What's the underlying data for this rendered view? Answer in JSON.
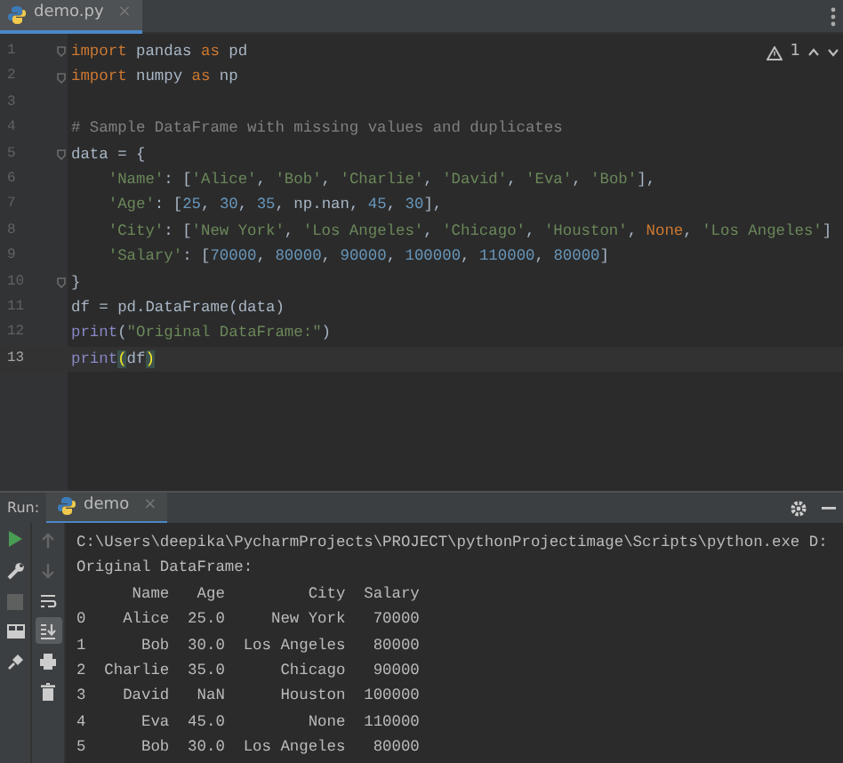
{
  "editor_tab": {
    "label": "demo.py",
    "close": "×",
    "selected": true
  },
  "inspection": {
    "count": "1"
  },
  "code_lines": [
    {
      "number": "1",
      "fold": true,
      "tokens": [
        {
          "kind": "kw",
          "text": "import"
        },
        {
          "kind": "p",
          "text": " pandas "
        },
        {
          "kind": "kw",
          "text": "as"
        },
        {
          "kind": "p",
          "text": " pd"
        }
      ]
    },
    {
      "number": "2",
      "fold": true,
      "tokens": [
        {
          "kind": "kw",
          "text": "import"
        },
        {
          "kind": "p",
          "text": " numpy "
        },
        {
          "kind": "kw",
          "text": "as"
        },
        {
          "kind": "p",
          "text": " np"
        }
      ]
    },
    {
      "number": "3",
      "fold": false
    },
    {
      "number": "4",
      "fold": false,
      "tokens": [
        {
          "kind": "cm",
          "text": "# Sample DataFrame with missing values and duplicates"
        }
      ]
    },
    {
      "number": "5",
      "fold": true,
      "tokens": [
        {
          "kind": "p",
          "text": "data = {"
        }
      ]
    },
    {
      "number": "6",
      "fold": false,
      "tokens": [
        {
          "kind": "s",
          "text": "    'Name'"
        },
        {
          "kind": "p",
          "text": ": ["
        },
        {
          "kind": "s",
          "text": "'Alice'"
        },
        {
          "kind": "p",
          "text": ", "
        },
        {
          "kind": "s",
          "text": "'Bob'"
        },
        {
          "kind": "p",
          "text": ", "
        },
        {
          "kind": "s",
          "text": "'Charlie'"
        },
        {
          "kind": "p",
          "text": ", "
        },
        {
          "kind": "s",
          "text": "'David'"
        },
        {
          "kind": "p",
          "text": ", "
        },
        {
          "kind": "s",
          "text": "'Eva'"
        },
        {
          "kind": "p",
          "text": ", "
        },
        {
          "kind": "s",
          "text": "'Bob'"
        },
        {
          "kind": "p",
          "text": "],"
        }
      ]
    },
    {
      "number": "7",
      "fold": false,
      "tokens": [
        {
          "kind": "s",
          "text": "    'Age'"
        },
        {
          "kind": "p",
          "text": ": ["
        },
        {
          "kind": "n",
          "text": "25"
        },
        {
          "kind": "p",
          "text": ", "
        },
        {
          "kind": "n",
          "text": "30"
        },
        {
          "kind": "p",
          "text": ", "
        },
        {
          "kind": "n",
          "text": "35"
        },
        {
          "kind": "p",
          "text": ", np.nan, "
        },
        {
          "kind": "n",
          "text": "45"
        },
        {
          "kind": "p",
          "text": ", "
        },
        {
          "kind": "n",
          "text": "30"
        },
        {
          "kind": "p",
          "text": "],"
        }
      ]
    },
    {
      "number": "8",
      "fold": false,
      "tokens": [
        {
          "kind": "s",
          "text": "    'City'"
        },
        {
          "kind": "p",
          "text": ": ["
        },
        {
          "kind": "s",
          "text": "'New York'"
        },
        {
          "kind": "p",
          "text": ", "
        },
        {
          "kind": "s",
          "text": "'Los Angeles'"
        },
        {
          "kind": "p",
          "text": ", "
        },
        {
          "kind": "s",
          "text": "'Chicago'"
        },
        {
          "kind": "p",
          "text": ", "
        },
        {
          "kind": "s",
          "text": "'Houston'"
        },
        {
          "kind": "p",
          "text": ", "
        },
        {
          "kind": "kw",
          "text": "None"
        },
        {
          "kind": "p",
          "text": ", "
        },
        {
          "kind": "s",
          "text": "'Los Angeles'"
        },
        {
          "kind": "p",
          "text": "]"
        }
      ]
    },
    {
      "number": "9",
      "fold": false,
      "tokens": [
        {
          "kind": "s",
          "text": "    'Salary'"
        },
        {
          "kind": "p",
          "text": ": ["
        },
        {
          "kind": "n",
          "text": "70000"
        },
        {
          "kind": "p",
          "text": ", "
        },
        {
          "kind": "n",
          "text": "80000"
        },
        {
          "kind": "p",
          "text": ", "
        },
        {
          "kind": "n",
          "text": "90000"
        },
        {
          "kind": "p",
          "text": ", "
        },
        {
          "kind": "n",
          "text": "100000"
        },
        {
          "kind": "p",
          "text": ", "
        },
        {
          "kind": "n",
          "text": "110000"
        },
        {
          "kind": "p",
          "text": ", "
        },
        {
          "kind": "n",
          "text": "80000"
        },
        {
          "kind": "p",
          "text": "]"
        }
      ]
    },
    {
      "number": "10",
      "fold": true,
      "tokens": [
        {
          "kind": "p",
          "text": "}"
        }
      ]
    },
    {
      "number": "11",
      "fold": false,
      "tokens": [
        {
          "kind": "p",
          "text": "df = pd.DataFrame(data)"
        }
      ]
    },
    {
      "number": "12",
      "fold": false,
      "tokens": [
        {
          "kind": "fn",
          "text": "print"
        },
        {
          "kind": "p",
          "text": "("
        },
        {
          "kind": "s",
          "text": "\"Original DataFrame:\""
        },
        {
          "kind": "p",
          "text": ")"
        }
      ]
    },
    {
      "number": "13",
      "fold": false,
      "current": true,
      "tokens": [
        {
          "kind": "fn",
          "text": "print"
        },
        {
          "kind": "br",
          "text": "("
        },
        {
          "kind": "p",
          "text": "df"
        },
        {
          "kind": "br",
          "text": ")"
        }
      ]
    }
  ],
  "run_panel": {
    "label": "Run:",
    "tab": {
      "label": "demo",
      "close": "×",
      "selected": true
    }
  },
  "console_lines": [
    "C:\\Users\\deepika\\PycharmProjects\\PROJECT\\pythonProjectimage\\Scripts\\python.exe D:",
    "Original DataFrame:",
    "      Name   Age         City  Salary",
    "0    Alice  25.0     New York   70000",
    "1      Bob  30.0  Los Angeles   80000",
    "2  Charlie  35.0      Chicago   90000",
    "3    David   NaN      Houston  100000",
    "4      Eva  45.0         None  110000",
    "5      Bob  30.0  Los Angeles   80000"
  ],
  "console_tools": [
    {
      "kind": "up",
      "selected": false
    },
    {
      "kind": "down",
      "selected": false
    },
    {
      "kind": "wrap",
      "selected": false
    },
    {
      "kind": "scroll-end",
      "selected": true
    },
    {
      "kind": "print",
      "selected": false
    },
    {
      "kind": "trash",
      "selected": false
    }
  ]
}
